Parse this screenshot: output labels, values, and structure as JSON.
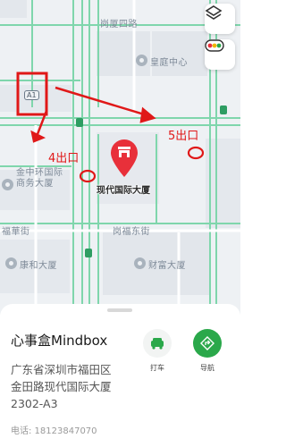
{
  "map": {
    "streets": {
      "gangxia_west_road": "岗厦四路",
      "fuhua_street": "福華街",
      "fuhua_east_street": "岗福东街"
    },
    "road_badge": "A1",
    "pois": {
      "huangting_center": "皇庭中心",
      "zhonghuan_center": "金中环国际商务大厦",
      "xinshikou_building": "康和大厦",
      "caifu_building": "财富大厦"
    },
    "destination_marker_label": "现代国际大厦"
  },
  "annotations": {
    "exit_4": "4出口",
    "exit_5": "5出口"
  },
  "controls": {
    "layers_icon": "layers-icon",
    "traffic_icon": "traffic-light-icon"
  },
  "place": {
    "name": "心事盒Mindbox",
    "address_lines": [
      "广东省深圳市福田区",
      "金田路现代国际大厦",
      "2302-A3"
    ],
    "phone": "电话: 18123847070"
  },
  "actions": {
    "taxi_label": "打车",
    "navigate_label": "导航"
  },
  "colors": {
    "annotation_red": "#e01818",
    "road_green": "#7fd6ac",
    "marker_red": "#e8303a",
    "nav_green": "#2aa84a"
  }
}
